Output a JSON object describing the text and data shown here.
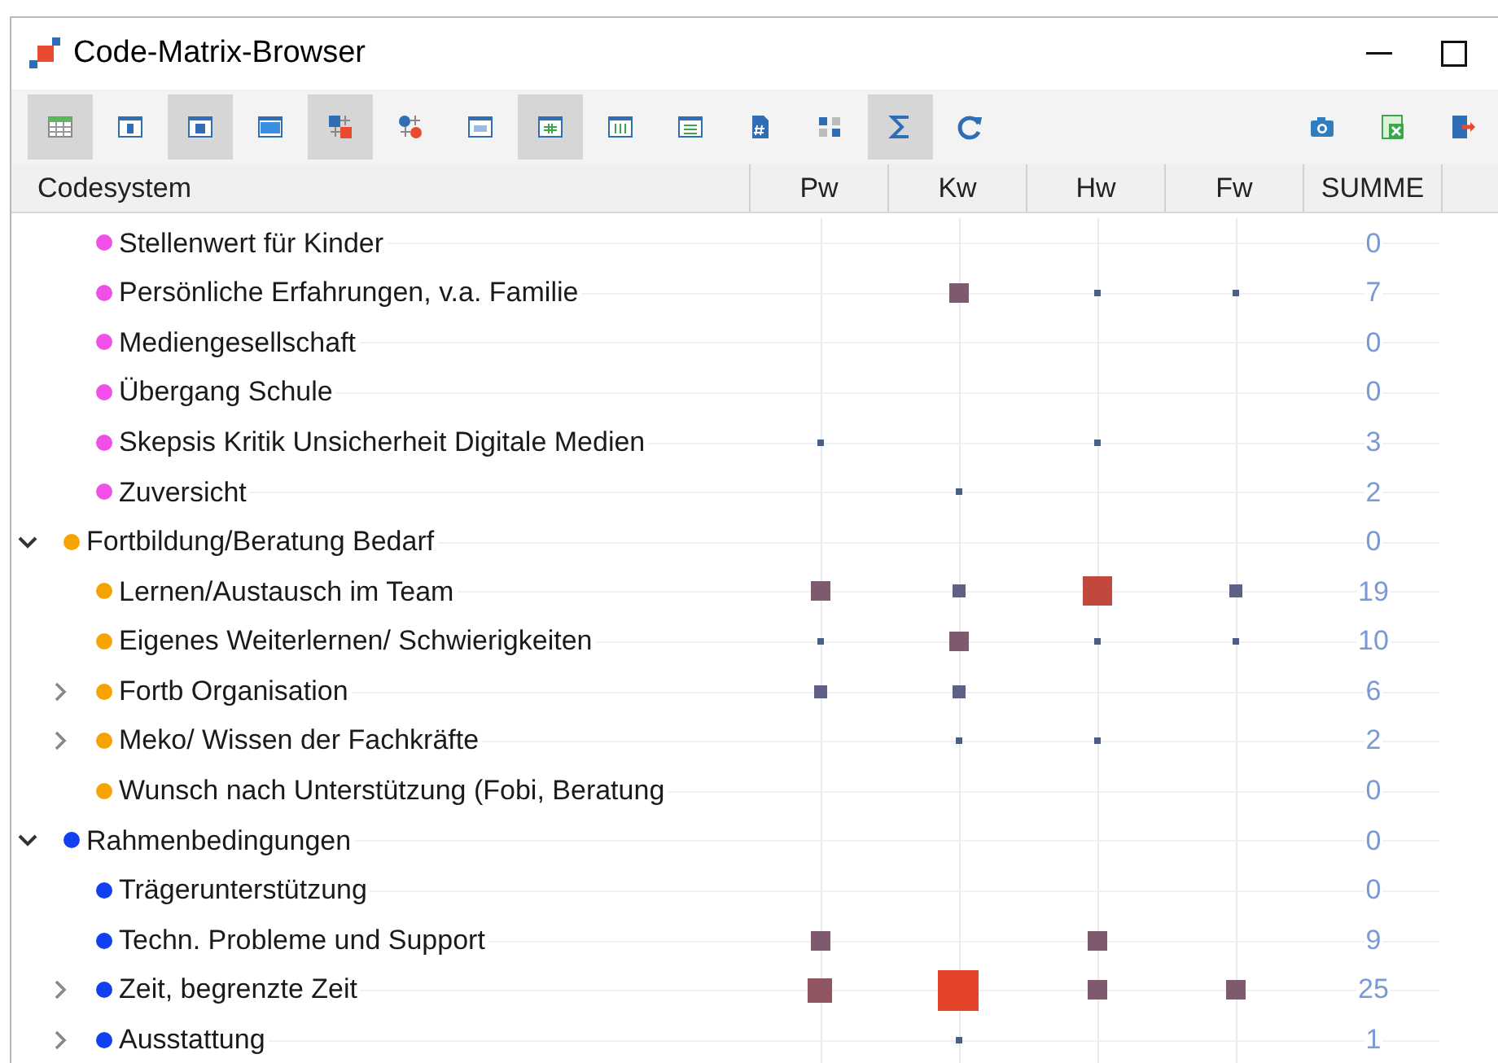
{
  "window": {
    "title": "Code-Matrix-Browser"
  },
  "toolbar": [
    {
      "kind": "grid",
      "selected": true
    },
    {
      "kind": "col-narrow",
      "selected": false
    },
    {
      "kind": "col-mid",
      "selected": true
    },
    {
      "kind": "col-wide",
      "selected": false
    },
    {
      "kind": "squares",
      "selected": true
    },
    {
      "kind": "circles",
      "selected": false
    },
    {
      "kind": "numbers",
      "selected": false
    },
    {
      "kind": "grid-green",
      "selected": true
    },
    {
      "kind": "columns",
      "selected": false
    },
    {
      "kind": "rows",
      "selected": false
    },
    {
      "kind": "hash-doc",
      "selected": false
    },
    {
      "kind": "matrix",
      "selected": false
    },
    {
      "kind": "sigma",
      "selected": true
    },
    {
      "kind": "refresh",
      "selected": false
    }
  ],
  "toolbar_right": [
    {
      "kind": "camera",
      "selected": false
    },
    {
      "kind": "excel",
      "selected": false
    },
    {
      "kind": "export",
      "selected": false
    }
  ],
  "table": {
    "columns": [
      "Codesystem",
      "Pw",
      "Kw",
      "Hw",
      "Fw",
      "SUMME"
    ],
    "codes": [
      {
        "children": [
          {
            "label": "Stellenwert für Kinder",
            "color": "#f050e8",
            "cells": [
              {
                "kind": "empty"
              },
              {
                "kind": "empty"
              },
              {
                "kind": "empty"
              },
              {
                "kind": "empty"
              }
            ],
            "sum": "0"
          },
          {
            "label": "Persönliche Erfahrungen, v.a. Familie",
            "color": "#f050e8",
            "cells": [
              {
                "kind": "empty"
              },
              {
                "kind": "medium"
              },
              {
                "kind": "dot"
              },
              {
                "kind": "dot"
              }
            ],
            "sum": "7"
          },
          {
            "label": "Mediengesellschaft",
            "color": "#f050e8",
            "cells": [
              {
                "kind": "empty"
              },
              {
                "kind": "empty"
              },
              {
                "kind": "empty"
              },
              {
                "kind": "empty"
              }
            ],
            "sum": "0"
          },
          {
            "label": "Übergang Schule",
            "color": "#f050e8",
            "cells": [
              {
                "kind": "empty"
              },
              {
                "kind": "empty"
              },
              {
                "kind": "empty"
              },
              {
                "kind": "empty"
              }
            ],
            "sum": "0"
          },
          {
            "label": "Skepsis Kritik Unsicherheit Digitale Medien",
            "color": "#f050e8",
            "cells": [
              {
                "kind": "dot"
              },
              {
                "kind": "empty"
              },
              {
                "kind": "dot"
              },
              {
                "kind": "empty"
              }
            ],
            "sum": "3"
          },
          {
            "label": "Zuversicht",
            "color": "#f050e8",
            "cells": [
              {
                "kind": "empty"
              },
              {
                "kind": "dot"
              },
              {
                "kind": "empty"
              },
              {
                "kind": "empty"
              }
            ],
            "sum": "2"
          }
        ]
      },
      {
        "label": "Fortbildung/Beratung Bedarf",
        "color": "#f5a300",
        "expanded": true,
        "cells": [
          {
            "kind": "empty"
          },
          {
            "kind": "empty"
          },
          {
            "kind": "empty"
          },
          {
            "kind": "empty"
          }
        ],
        "sum": "0",
        "children": [
          {
            "label": "Lernen/Austausch im Team",
            "color": "#f5a300",
            "cells": [
              {
                "kind": "medium"
              },
              {
                "kind": "small"
              },
              {
                "kind": "large"
              },
              {
                "kind": "small"
              }
            ],
            "sum": "19"
          },
          {
            "label": "Eigenes Weiterlernen/ Schwierigkeiten",
            "color": "#f5a300",
            "cells": [
              {
                "kind": "dot"
              },
              {
                "kind": "medium"
              },
              {
                "kind": "dot"
              },
              {
                "kind": "dot"
              }
            ],
            "sum": "10"
          },
          {
            "label": "Fortb Organisation",
            "color": "#f5a300",
            "expanded": false,
            "cells": [
              {
                "kind": "small"
              },
              {
                "kind": "small"
              },
              {
                "kind": "empty"
              },
              {
                "kind": "empty"
              }
            ],
            "sum": "6"
          },
          {
            "label": "Meko/ Wissen der Fachkräfte",
            "color": "#f5a300",
            "expanded": false,
            "cells": [
              {
                "kind": "empty"
              },
              {
                "kind": "dot"
              },
              {
                "kind": "dot"
              },
              {
                "kind": "empty"
              }
            ],
            "sum": "2"
          },
          {
            "label": "Wunsch nach Unterstützung (Fobi, Beratung",
            "color": "#f5a300",
            "cells": [
              {
                "kind": "empty"
              },
              {
                "kind": "empty"
              },
              {
                "kind": "empty"
              },
              {
                "kind": "empty"
              }
            ],
            "sum": "0"
          }
        ]
      },
      {
        "label": "Rahmenbedingungen",
        "color": "#1040f0",
        "expanded": true,
        "cells": [
          {
            "kind": "empty"
          },
          {
            "kind": "empty"
          },
          {
            "kind": "empty"
          },
          {
            "kind": "empty"
          }
        ],
        "sum": "0",
        "children": [
          {
            "label": "Trägerunterstützung",
            "color": "#1040f0",
            "cells": [
              {
                "kind": "empty"
              },
              {
                "kind": "empty"
              },
              {
                "kind": "empty"
              },
              {
                "kind": "empty"
              }
            ],
            "sum": "0"
          },
          {
            "label": "Techn. Probleme und Support",
            "color": "#1040f0",
            "cells": [
              {
                "kind": "medium"
              },
              {
                "kind": "empty"
              },
              {
                "kind": "medium"
              },
              {
                "kind": "empty"
              }
            ],
            "sum": "9"
          },
          {
            "label": "Zeit, begrenzte Zeit",
            "color": "#1040f0",
            "expanded": false,
            "cells": [
              {
                "kind": "big"
              },
              {
                "kind": "xlarge"
              },
              {
                "kind": "medium"
              },
              {
                "kind": "medium"
              }
            ],
            "sum": "25"
          },
          {
            "label": "Ausstattung",
            "color": "#1040f0",
            "expanded": false,
            "cells": [
              {
                "kind": "empty"
              },
              {
                "kind": "dot"
              },
              {
                "kind": "empty"
              },
              {
                "kind": "empty"
              }
            ],
            "sum": "1"
          }
        ]
      }
    ]
  }
}
